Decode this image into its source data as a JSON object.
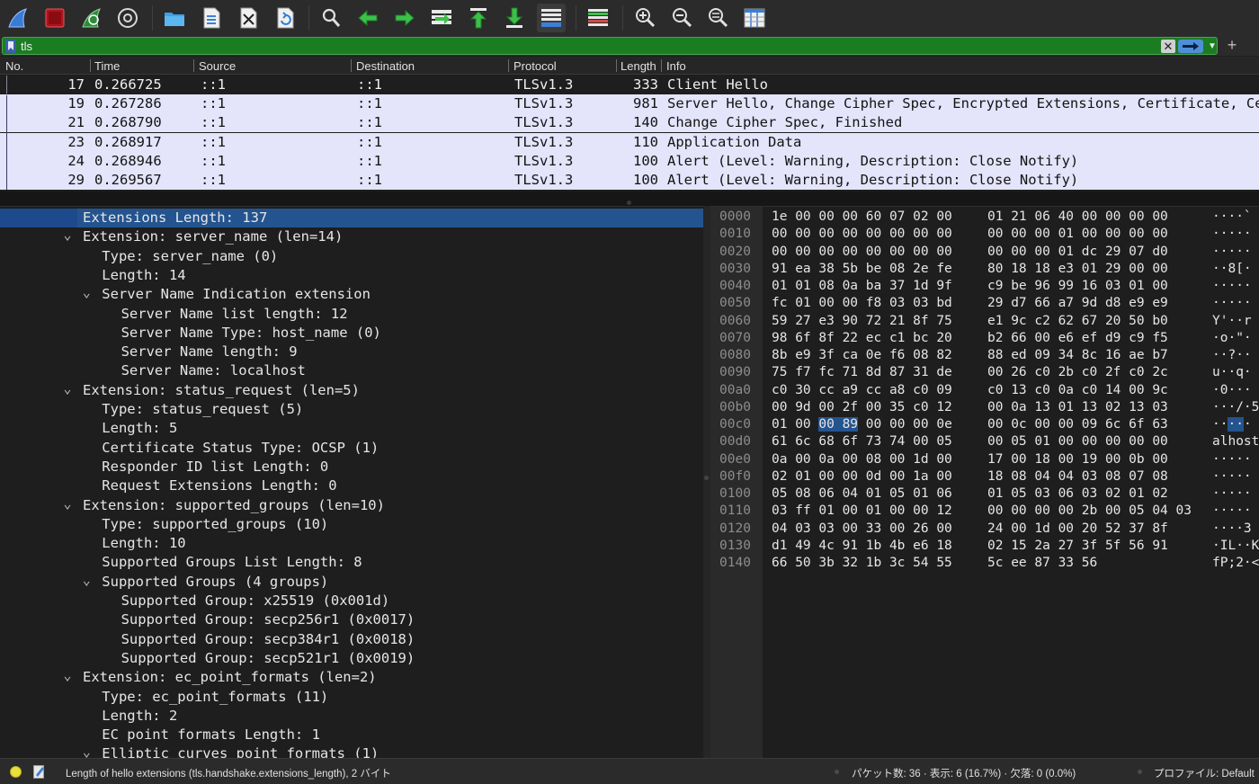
{
  "filter": {
    "value": "tls",
    "placeholder": ""
  },
  "packet_list": {
    "columns": [
      "No.",
      "Time",
      "Source",
      "Destination",
      "Protocol",
      "Length",
      "Info"
    ],
    "rows": [
      {
        "no": "17",
        "time": "0.266725",
        "src": "::1",
        "dst": "::1",
        "proto": "TLSv1.3",
        "len": "333",
        "info": "Client Hello"
      },
      {
        "no": "19",
        "time": "0.267286",
        "src": "::1",
        "dst": "::1",
        "proto": "TLSv1.3",
        "len": "981",
        "info": "Server Hello, Change Cipher Spec, Encrypted Extensions, Certificate, Certificate Verify, Finished"
      },
      {
        "no": "21",
        "time": "0.268790",
        "src": "::1",
        "dst": "::1",
        "proto": "TLSv1.3",
        "len": "140",
        "info": "Change Cipher Spec, Finished"
      },
      {
        "no": "23",
        "time": "0.268917",
        "src": "::1",
        "dst": "::1",
        "proto": "TLSv1.3",
        "len": "110",
        "info": "Application Data"
      },
      {
        "no": "24",
        "time": "0.268946",
        "src": "::1",
        "dst": "::1",
        "proto": "TLSv1.3",
        "len": "100",
        "info": "Alert (Level: Warning, Description: Close Notify)"
      },
      {
        "no": "29",
        "time": "0.269567",
        "src": "::1",
        "dst": "::1",
        "proto": "TLSv1.3",
        "len": "100",
        "info": "Alert (Level: Warning, Description: Close Notify)"
      }
    ]
  },
  "details": [
    {
      "indent": 0,
      "caret": "",
      "text": "Extensions Length: 137",
      "selected": true
    },
    {
      "indent": 0,
      "caret": "open",
      "text": "Extension: server_name (len=14)"
    },
    {
      "indent": 1,
      "caret": "",
      "text": "Type: server_name (0)"
    },
    {
      "indent": 1,
      "caret": "",
      "text": "Length: 14"
    },
    {
      "indent": 1,
      "caret": "open",
      "text": "Server Name Indication extension"
    },
    {
      "indent": 2,
      "caret": "",
      "text": "Server Name list length: 12"
    },
    {
      "indent": 2,
      "caret": "",
      "text": "Server Name Type: host_name (0)"
    },
    {
      "indent": 2,
      "caret": "",
      "text": "Server Name length: 9"
    },
    {
      "indent": 2,
      "caret": "",
      "text": "Server Name: localhost"
    },
    {
      "indent": 0,
      "caret": "open",
      "text": "Extension: status_request (len=5)"
    },
    {
      "indent": 1,
      "caret": "",
      "text": "Type: status_request (5)"
    },
    {
      "indent": 1,
      "caret": "",
      "text": "Length: 5"
    },
    {
      "indent": 1,
      "caret": "",
      "text": "Certificate Status Type: OCSP (1)"
    },
    {
      "indent": 1,
      "caret": "",
      "text": "Responder ID list Length: 0"
    },
    {
      "indent": 1,
      "caret": "",
      "text": "Request Extensions Length: 0"
    },
    {
      "indent": 0,
      "caret": "open",
      "text": "Extension: supported_groups (len=10)"
    },
    {
      "indent": 1,
      "caret": "",
      "text": "Type: supported_groups (10)"
    },
    {
      "indent": 1,
      "caret": "",
      "text": "Length: 10"
    },
    {
      "indent": 1,
      "caret": "",
      "text": "Supported Groups List Length: 8"
    },
    {
      "indent": 1,
      "caret": "open",
      "text": "Supported Groups (4 groups)"
    },
    {
      "indent": 2,
      "caret": "",
      "text": "Supported Group: x25519 (0x001d)"
    },
    {
      "indent": 2,
      "caret": "",
      "text": "Supported Group: secp256r1 (0x0017)"
    },
    {
      "indent": 2,
      "caret": "",
      "text": "Supported Group: secp384r1 (0x0018)"
    },
    {
      "indent": 2,
      "caret": "",
      "text": "Supported Group: secp521r1 (0x0019)"
    },
    {
      "indent": 0,
      "caret": "open",
      "text": "Extension: ec_point_formats (len=2)"
    },
    {
      "indent": 1,
      "caret": "",
      "text": "Type: ec_point_formats (11)"
    },
    {
      "indent": 1,
      "caret": "",
      "text": "Length: 2"
    },
    {
      "indent": 1,
      "caret": "",
      "text": "EC point formats Length: 1"
    },
    {
      "indent": 1,
      "caret": "open",
      "text": "Elliptic curves point formats (1)"
    }
  ],
  "hex": [
    {
      "off": "0000",
      "a": "1e 00 00 00 60 07 02 00",
      "b": "01 21 06 40 00 00 00 00",
      "ascii": "····`"
    },
    {
      "off": "0010",
      "a": "00 00 00 00 00 00 00 00",
      "b": "00 00 00 01 00 00 00 00",
      "ascii": "·····"
    },
    {
      "off": "0020",
      "a": "00 00 00 00 00 00 00 00",
      "b": "00 00 00 01 dc 29 07 d0",
      "ascii": "·····"
    },
    {
      "off": "0030",
      "a": "91 ea 38 5b be 08 2e fe",
      "b": "80 18 18 e3 01 29 00 00",
      "ascii": "··8[·"
    },
    {
      "off": "0040",
      "a": "01 01 08 0a ba 37 1d 9f",
      "b": "c9 be 96 99 16 03 01 00",
      "ascii": "·····"
    },
    {
      "off": "0050",
      "a": "fc 01 00 00 f8 03 03 bd",
      "b": "29 d7 66 a7 9d d8 e9 e9",
      "ascii": "·····"
    },
    {
      "off": "0060",
      "a": "59 27 e3 90 72 21 8f 75",
      "b": "e1 9c c2 62 67 20 50 b0",
      "ascii": "Y'··r"
    },
    {
      "off": "0070",
      "a": "98 6f 8f 22 ec c1 bc 20",
      "b": "b2 66 00 e6 ef d9 c9 f5",
      "ascii": "·o·\"·"
    },
    {
      "off": "0080",
      "a": "8b e9 3f ca 0e f6 08 82",
      "b": "88 ed 09 34 8c 16 ae b7",
      "ascii": "··?··"
    },
    {
      "off": "0090",
      "a": "75 f7 fc 71 8d 87 31 de",
      "b": "00 26 c0 2b c0 2f c0 2c",
      "ascii": "u··q·"
    },
    {
      "off": "00a0",
      "a": "c0 30 cc a9 cc a8 c0 09",
      "b": "c0 13 c0 0a c0 14 00 9c",
      "ascii": "·0···"
    },
    {
      "off": "00b0",
      "a": "00 9d 00 2f 00 35 c0 12",
      "b": "00 0a 13 01 13 02 13 03",
      "ascii": "···/·5"
    },
    {
      "off": "00c0",
      "a": "01 00 00 89 00 00 00 0e",
      "b": "00 0c 00 00 09 6c 6f 63",
      "ascii": "·····"
    },
    {
      "off": "00d0",
      "a": "61 6c 68 6f 73 74 00 05",
      "b": "00 05 01 00 00 00 00 00",
      "ascii": "alhost"
    },
    {
      "off": "00e0",
      "a": "0a 00 0a 00 08 00 1d 00",
      "b": "17 00 18 00 19 00 0b 00",
      "ascii": "·····"
    },
    {
      "off": "00f0",
      "a": "02 01 00 00 0d 00 1a 00",
      "b": "18 08 04 04 03 08 07 08",
      "ascii": "·····"
    },
    {
      "off": "0100",
      "a": "05 08 06 04 01 05 01 06",
      "b": "01 05 03 06 03 02 01 02",
      "ascii": "·····"
    },
    {
      "off": "0110",
      "a": "03 ff 01 00 01 00 00 12",
      "b": "00 00 00 00 2b 00 05 04 03",
      "ascii": "·····"
    },
    {
      "off": "0120",
      "a": "04 03 03 00 33 00 26 00",
      "b": "24 00 1d 00 20 52 37 8f",
      "ascii": "····3"
    },
    {
      "off": "0130",
      "a": "d1 49 4c 91 1b 4b e6 18",
      "b": "02 15 2a 27 3f 5f 56 91",
      "ascii": "·IL··K"
    },
    {
      "off": "0140",
      "a": "66 50 3b 32 1b 3c 54 55",
      "b": "5c ee 87 33 56",
      "ascii": "fP;2·<"
    }
  ],
  "status": {
    "text": "Length of hello extensions (tls.handshake.extensions_length), 2 バイト",
    "counts": "パケット数: 36 · 表示: 6 (16.7%) · 欠落: 0 (0.0%)",
    "profile": "プロファイル: Default"
  },
  "colors": {
    "tls_row": "#e4e4fb",
    "filter_ok": "#1b7d22",
    "selection": "#24548f"
  },
  "toolbar_icons": [
    "shark-fin-start-icon",
    "stop-capture-icon",
    "restart-capture-icon",
    "capture-options-icon",
    "open-folder-icon",
    "open-file-icon",
    "close-file-icon",
    "reload-icon",
    "find-packet-icon",
    "go-back-icon",
    "go-forward-icon",
    "go-to-packet-icon",
    "first-packet-icon",
    "last-packet-icon",
    "auto-scroll-icon",
    "colorize-icon",
    "zoom-in-icon",
    "zoom-out-icon",
    "zoom-normal-icon",
    "resize-columns-icon"
  ]
}
